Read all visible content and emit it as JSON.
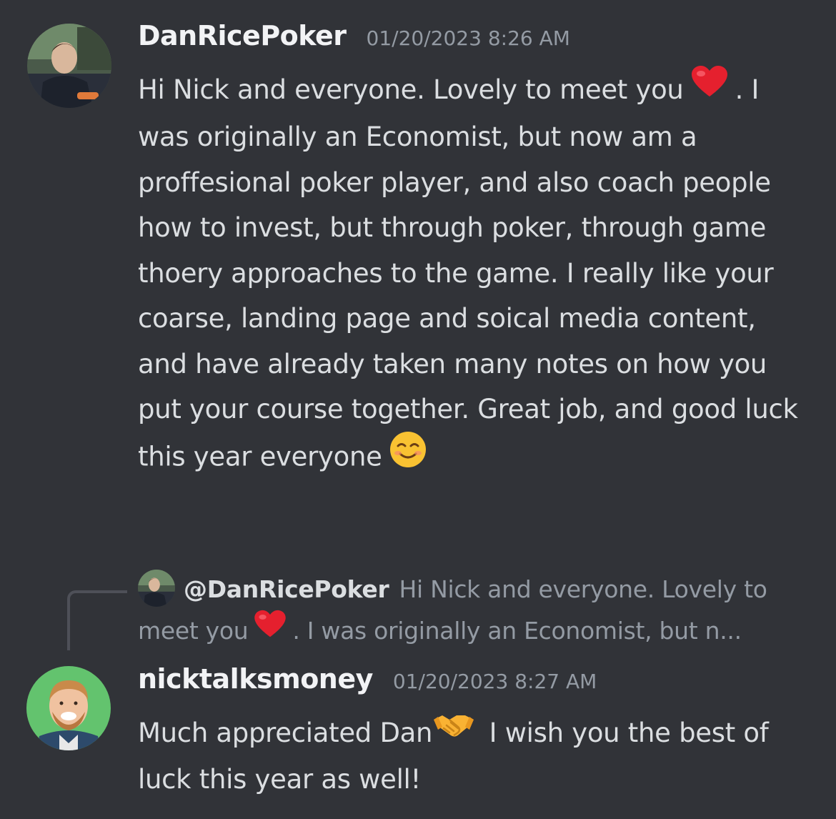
{
  "messages": [
    {
      "username": "DanRicePoker",
      "timestamp": "01/20/2023 8:26 AM",
      "text_parts": [
        "Hi Nick and everyone. Lovely to meet you",
        ". I was originally an Economist, but now am a proffesional poker player,  and also coach people how to invest, but through poker, through game thoery approaches to the game. I really like your coarse, landing page and soical media content, and have already taken many notes on how you put your course together. Great job, and good luck this year everyone"
      ],
      "emojis": [
        "red-heart",
        "smiling-face"
      ]
    },
    {
      "username": "nicktalksmoney",
      "timestamp": "01/20/2023 8:27 AM",
      "reply": {
        "mention": "@DanRicePoker",
        "preview_parts": [
          "Hi Nick and everyone. Lovely to meet you",
          ". I was originally an Economist, but n..."
        ]
      },
      "text_parts": [
        "Much appreciated Dan",
        " I wish you the best of luck this year as well!"
      ],
      "emojis": [
        "handshake"
      ]
    }
  ],
  "colors": {
    "background": "#313338",
    "username": "#f2f3f5",
    "text": "#dbdee1",
    "muted": "#949ba4",
    "avatar_green": "#63c36e"
  }
}
